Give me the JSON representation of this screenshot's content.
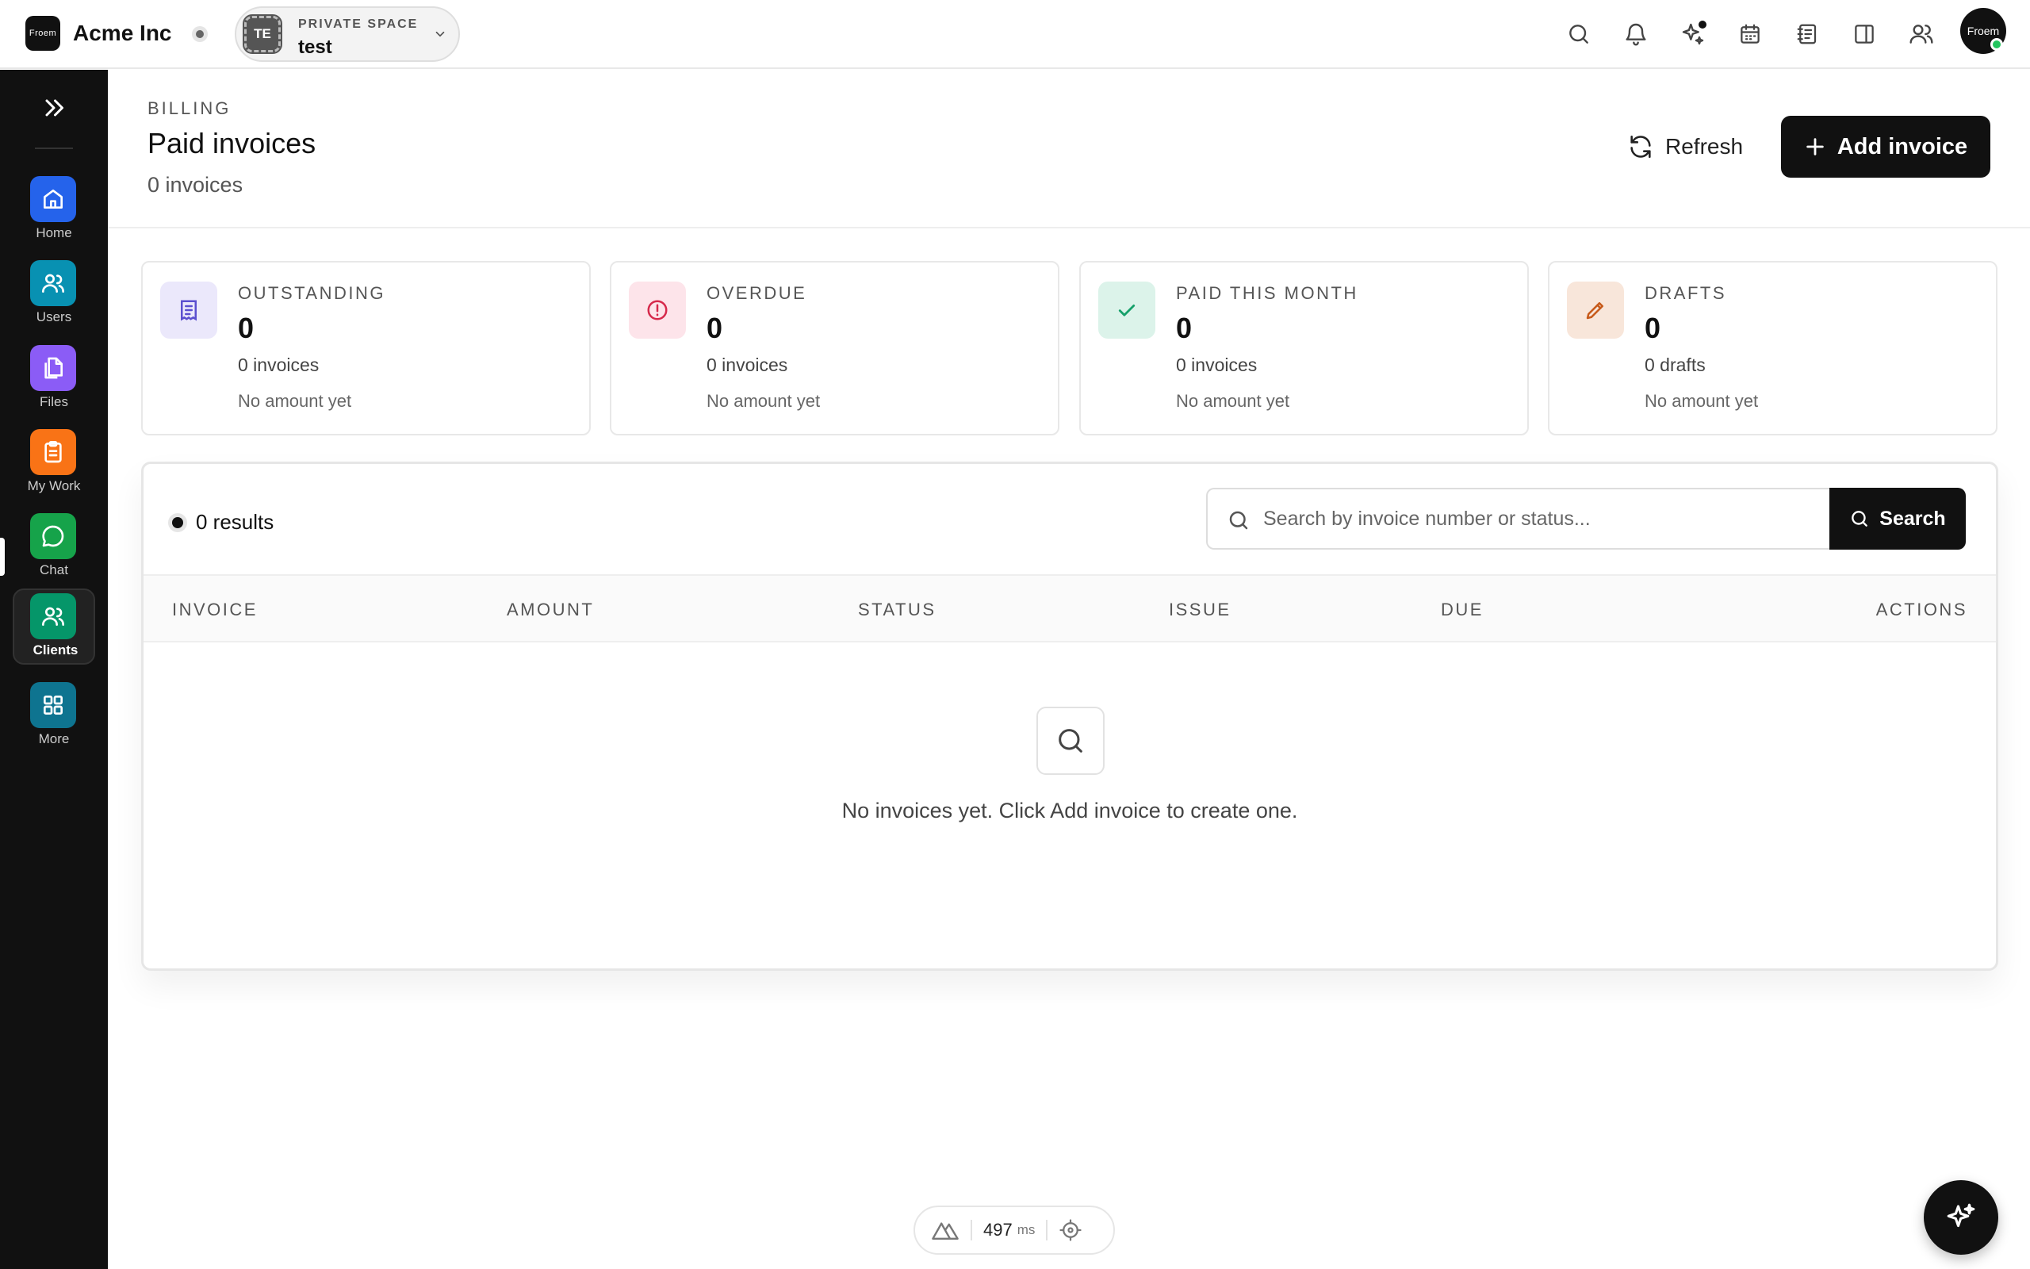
{
  "app": {
    "logo_text": "Froem",
    "title": "Acme Inc"
  },
  "space": {
    "avatar": "TE",
    "label": "PRIVATE SPACE",
    "name": "test"
  },
  "user": {
    "avatar_text": "Froem"
  },
  "top_icons": [
    "search-icon",
    "bell-icon",
    "sparkles-icon",
    "calendar-icon",
    "notebook-icon",
    "panel-icon",
    "people-icon"
  ],
  "sidebar": {
    "items": [
      {
        "label": "Home",
        "color": "#2563eb"
      },
      {
        "label": "Users",
        "color": "#0891b2"
      },
      {
        "label": "Files",
        "color": "#8b5cf6"
      },
      {
        "label": "My Work",
        "color": "#f97316"
      },
      {
        "label": "Chat",
        "color": "#16a34a"
      },
      {
        "label": "Clients",
        "color": "#059669"
      },
      {
        "label": "More",
        "color": "#0e7490"
      }
    ]
  },
  "header": {
    "eyebrow": "BILLING",
    "title": "Paid invoices",
    "subtitle": "0 invoices",
    "refresh_label": "Refresh",
    "add_label": "Add invoice"
  },
  "stats": [
    {
      "label": "OUTSTANDING",
      "value": "0",
      "count": "0 invoices",
      "note": "No amount yet",
      "bg": "#ebe8fb",
      "fg": "#5b4fcf"
    },
    {
      "label": "OVERDUE",
      "value": "0",
      "count": "0 invoices",
      "note": "No amount yet",
      "bg": "#fde4ea",
      "fg": "#d6294b"
    },
    {
      "label": "PAID THIS MONTH",
      "value": "0",
      "count": "0 invoices",
      "note": "No amount yet",
      "bg": "#dcf3ea",
      "fg": "#15a06a"
    },
    {
      "label": "DRAFTS",
      "value": "0",
      "count": "0 drafts",
      "note": "No amount yet",
      "bg": "#f8e6da",
      "fg": "#c75a1a"
    }
  ],
  "table": {
    "results": "0 results",
    "search_placeholder": "Search by invoice number or status...",
    "search_button": "Search",
    "columns": [
      "INVOICE",
      "AMOUNT",
      "STATUS",
      "ISSUE",
      "DUE",
      "ACTIONS"
    ],
    "empty_message": "No invoices yet. Click Add invoice to create one."
  },
  "perf": {
    "value": "497",
    "unit": "ms"
  }
}
